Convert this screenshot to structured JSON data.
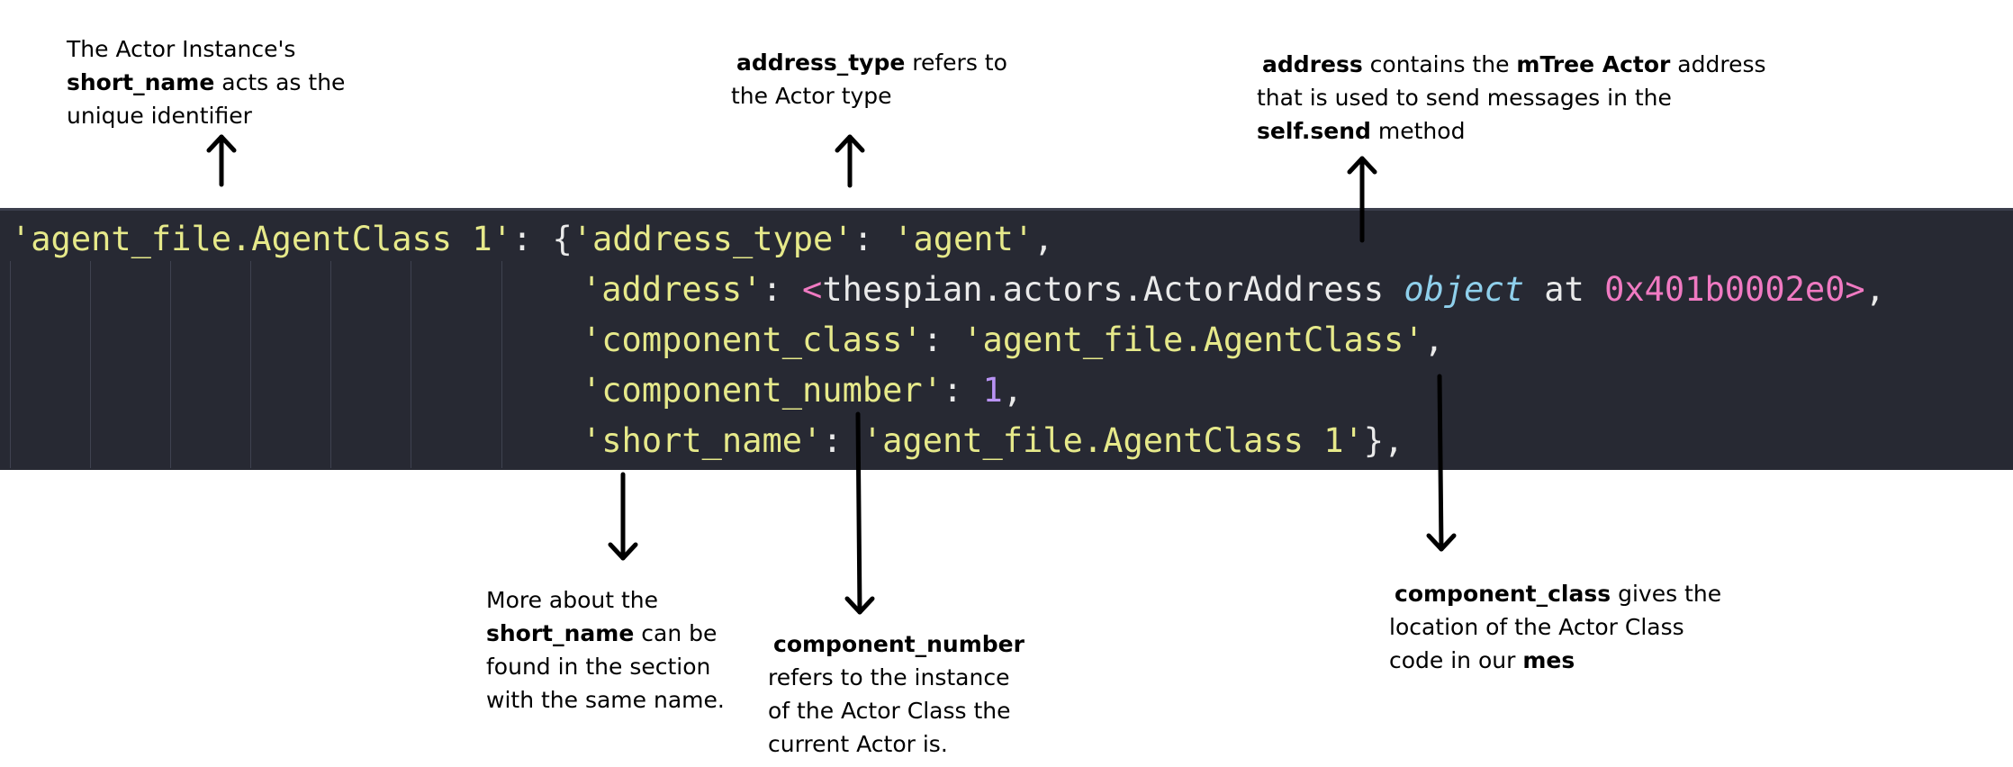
{
  "annotations": {
    "short_name_top": {
      "line1": "The Actor Instance's",
      "line2_bold": "short_name",
      "line2_rest": " acts as the",
      "line3": "unique identifier"
    },
    "address_type": {
      "line1_bold": "address_type",
      "line1_rest": " refers to",
      "line2": "the Actor type"
    },
    "address": {
      "line1_bold": "address",
      "line1_mid": " contains the ",
      "line1_bold2": "mTree Actor",
      "line1_rest": " address",
      "line2": "that is used to send messages in the",
      "line3_bold": "self.send",
      "line3_rest": " method"
    },
    "short_name_bottom": {
      "line1": "More about the",
      "line2_bold": "short_name",
      "line2_rest": " can be",
      "line3": "found in the section",
      "line4": "with the same name."
    },
    "component_number": {
      "line1_bold": "component_number",
      "line2": "refers to the instance",
      "line3": "of the Actor Class the",
      "line4": "current Actor is."
    },
    "component_class": {
      "line1_bold": "component_class",
      "line1_rest": " gives the",
      "line2": "location of the Actor Class",
      "line3_pre": "code in our ",
      "line3_bold": "mes"
    }
  },
  "code": {
    "key": "'agent_file.AgentClass 1'",
    "colon_brace": ": {",
    "address_type_key": "'address_type'",
    "address_type_val": "'agent'",
    "address_key": "'address'",
    "lt": "<",
    "address_class": "thespian.actors.ActorAddress ",
    "object_kw": "object",
    "at_kw": " at ",
    "hex": "0x401b0002e0",
    "gt": ">",
    "component_class_key": "'component_class'",
    "component_class_val": "'agent_file.AgentClass'",
    "component_number_key": "'component_number'",
    "component_number_val": "1",
    "short_name_key": "'short_name'",
    "short_name_val": "'agent_file.AgentClass 1'",
    "close": "},",
    "colon": ": ",
    "comma": ","
  },
  "colors": {
    "code_background": "#272933",
    "string": "#e6e98a",
    "number": "#b993f5",
    "keyword": "#8fd0ec",
    "hex": "#f07ac2"
  }
}
